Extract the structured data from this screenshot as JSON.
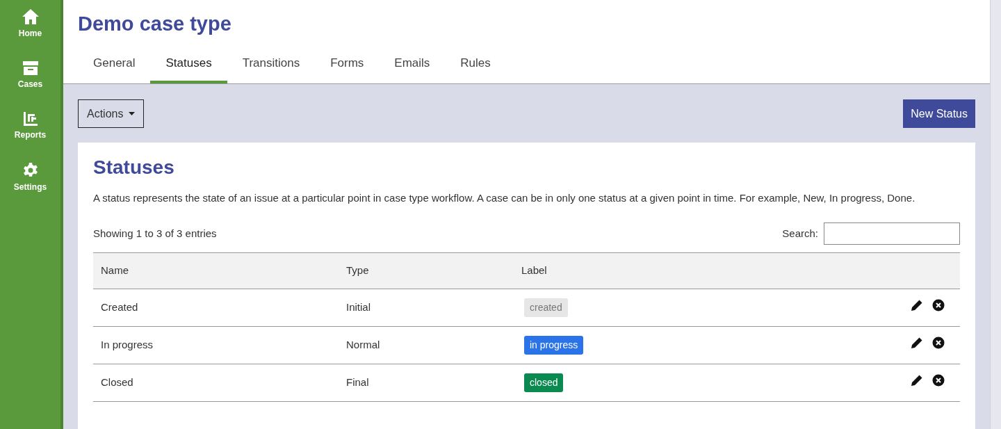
{
  "sidebar": {
    "items": [
      {
        "label": "Home"
      },
      {
        "label": "Cases"
      },
      {
        "label": "Reports"
      },
      {
        "label": "Settings"
      }
    ]
  },
  "header": {
    "title": "Demo case type"
  },
  "tabs": [
    {
      "label": "General",
      "selected": false
    },
    {
      "label": "Statuses",
      "selected": true
    },
    {
      "label": "Transitions",
      "selected": false
    },
    {
      "label": "Forms",
      "selected": false
    },
    {
      "label": "Emails",
      "selected": false
    },
    {
      "label": "Rules",
      "selected": false
    }
  ],
  "toolbar": {
    "actions": "Actions",
    "new_button": "New Status"
  },
  "panel": {
    "title": "Statuses",
    "description": "A status represents the state of an issue at a particular point in case type workflow. A case can be in only one status at a given point in time. For example, New, In progress, Done.",
    "info": "Showing 1 to 3 of 3 entries",
    "search_label": "Search:"
  },
  "table": {
    "columns": [
      "Name",
      "Type",
      "Label"
    ],
    "rows": [
      {
        "name": "Created",
        "type": "Initial",
        "label": "created",
        "color": "#e6e6e6"
      },
      {
        "name": "In progress",
        "type": "Normal",
        "label": "in progress",
        "color": "#2a73e8"
      },
      {
        "name": "Closed",
        "type": "Final",
        "label": "closed",
        "color": "#0b8a4f"
      }
    ]
  }
}
